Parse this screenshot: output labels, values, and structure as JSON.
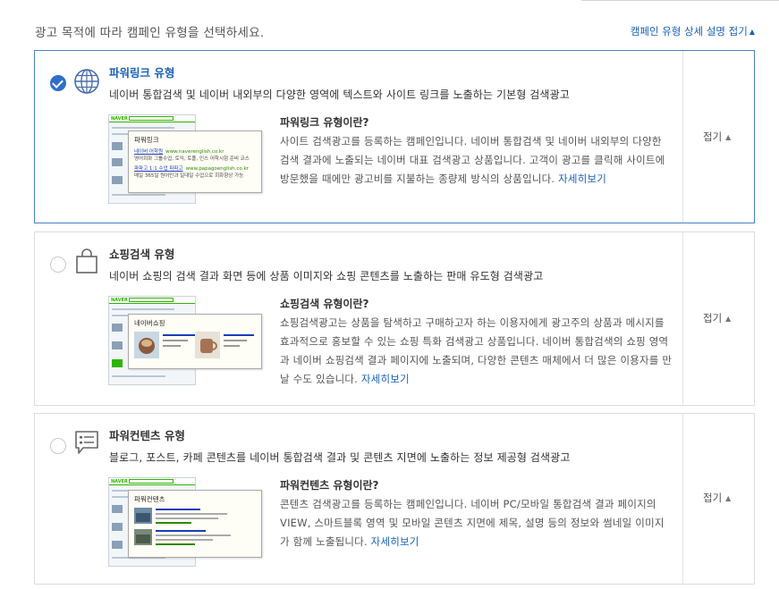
{
  "prompt": "광고 목적에 따라 캠페인 유형을 선택하세요.",
  "collapse_all_label": "캠페인 유형 상세 설명 접기",
  "accent_color": "#1a61b8",
  "selected_border_color": "#4a7fc9",
  "cards": [
    {
      "title": "파워링크 유형",
      "selected": true,
      "icon": "globe-icon",
      "description": "네이버 통합검색 및 네이버 내외부의 다양한 영역에 텍스트와 사이트 링크를 노출하는 기본형 검색광고",
      "info_title": "파워링크 유형이란?",
      "info_body": "사이트 검색광고를 등록하는 캠페인입니다. 네이버 통합검색 및 네이버 내외부의 다양한 검색 결과에 노출되는 네이버 대표 검색광고 상품입니다. 고객이 광고를 클릭해 사이트에 방문했을 때에만 광고비를 지불하는 종량제 방식의 상품입니다.",
      "more_label": "자세히보기",
      "toggle_label": "접기",
      "thumb": {
        "logo": "NAVER",
        "popup_title": "파워링크",
        "lines": [
          {
            "link": "네이버 어학원",
            "url": "www.naverenglish.co.kr"
          },
          {
            "text": "영어회화 그룹수업, 토익, 토플, 인스 어학시험 준비 코스"
          },
          {
            "link": "파파고 1:1 수업 파파고",
            "url": "www.papagoenglish.co.kr"
          },
          {
            "text": "매일 365일 원어민과 일대일 수업으로 회화향상 가능"
          }
        ]
      }
    },
    {
      "title": "쇼핑검색 유형",
      "selected": false,
      "icon": "shopping-bag-icon",
      "description": "네이버 쇼핑의 검색 결과 화면 등에 상품 이미지와 쇼핑 콘텐츠를 노출하는 판매 유도형 검색광고",
      "info_title": "쇼핑검색 유형이란?",
      "info_body": "쇼핑검색광고는 상품을 탐색하고 구매하고자 하는 이용자에게 광고주의 상품과 메시지를 효과적으로 홍보할 수 있는 쇼핑 특화 검색광고 상품입니다. 네이버 통합검색의 쇼핑 영역과 네이버 쇼핑검색 결과 페이지에 노출되며, 다양한 콘텐츠 매체에서 더 많은 이용자를 만날 수도 있습니다.",
      "more_label": "자세히보기",
      "toggle_label": "접기",
      "thumb": {
        "logo": "NAVER",
        "popup_title": "네이버쇼핑"
      }
    },
    {
      "title": "파워컨텐츠 유형",
      "selected": false,
      "icon": "content-card-icon",
      "description": "블로그, 포스트, 카페 콘텐츠를 네이버 통합검색 결과 및 콘텐츠 지면에 노출하는 정보 제공형 검색광고",
      "info_title": "파워컨텐츠 유형이란?",
      "info_body": "콘텐츠 검색광고를 등록하는 캠페인입니다. 네이버 PC/모바일 통합검색 결과 페이지의 VIEW, 스마트블록 영역 및 모바일 콘텐츠 지면에 제목, 설명 등의 정보와 썸네일 이미지가 함께 노출됩니다.",
      "more_label": "자세히보기",
      "toggle_label": "접기",
      "thumb": {
        "logo": "NAVER",
        "popup_title": "파워컨텐츠"
      }
    }
  ]
}
